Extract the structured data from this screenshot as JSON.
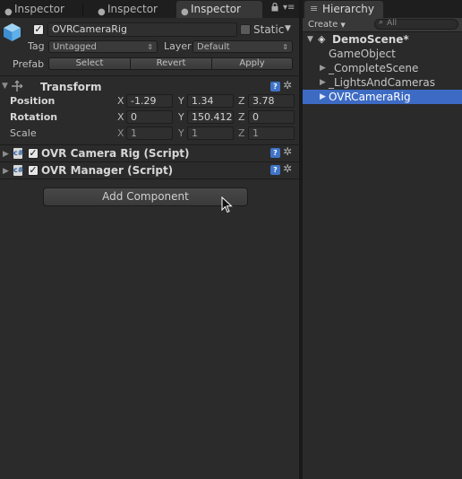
{
  "tabs": [
    {
      "label": "Inspector",
      "icon": "info-icon",
      "active": false
    },
    {
      "label": "Inspector",
      "icon": "info-icon",
      "active": false
    },
    {
      "label": "Inspector",
      "icon": "info-icon",
      "active": true
    }
  ],
  "object": {
    "name": "OVRCameraRig",
    "active_checked": true,
    "static_label": "Static",
    "tag_label": "Tag",
    "tag_value": "Untagged",
    "layer_label": "Layer",
    "layer_value": "Default",
    "prefab_label": "Prefab",
    "prefab_select": "Select",
    "prefab_revert": "Revert",
    "prefab_apply": "Apply"
  },
  "transform": {
    "title": "Transform",
    "rows": [
      {
        "label": "Position",
        "x": "-1.29",
        "y": "1.34",
        "z": "3.78"
      },
      {
        "label": "Rotation",
        "x": "0",
        "y": "150.412",
        "z": "0"
      },
      {
        "label": "Scale",
        "x": "1",
        "y": "1",
        "z": "1"
      }
    ],
    "axis_x": "X",
    "axis_y": "Y",
    "axis_z": "Z"
  },
  "components": [
    {
      "title": "OVR Camera Rig (Script)",
      "enabled": true
    },
    {
      "title": "OVR Manager (Script)",
      "enabled": true
    }
  ],
  "add_component_label": "Add Component",
  "hierarchy": {
    "tab_label": "Hierarchy",
    "create_label": "Create",
    "search_placeholder": "All",
    "scene": "DemoScene*",
    "items": [
      {
        "label": "GameObject",
        "expandable": false,
        "selected": false
      },
      {
        "label": "_CompleteScene",
        "expandable": true,
        "selected": false
      },
      {
        "label": "_LightsAndCameras",
        "expandable": true,
        "selected": false
      },
      {
        "label": "OVRCameraRig",
        "expandable": true,
        "selected": true
      }
    ]
  },
  "colors": {
    "selection": "#3d6bc4",
    "panel": "#2b2b2b",
    "help_icon": "#3f74c7"
  }
}
